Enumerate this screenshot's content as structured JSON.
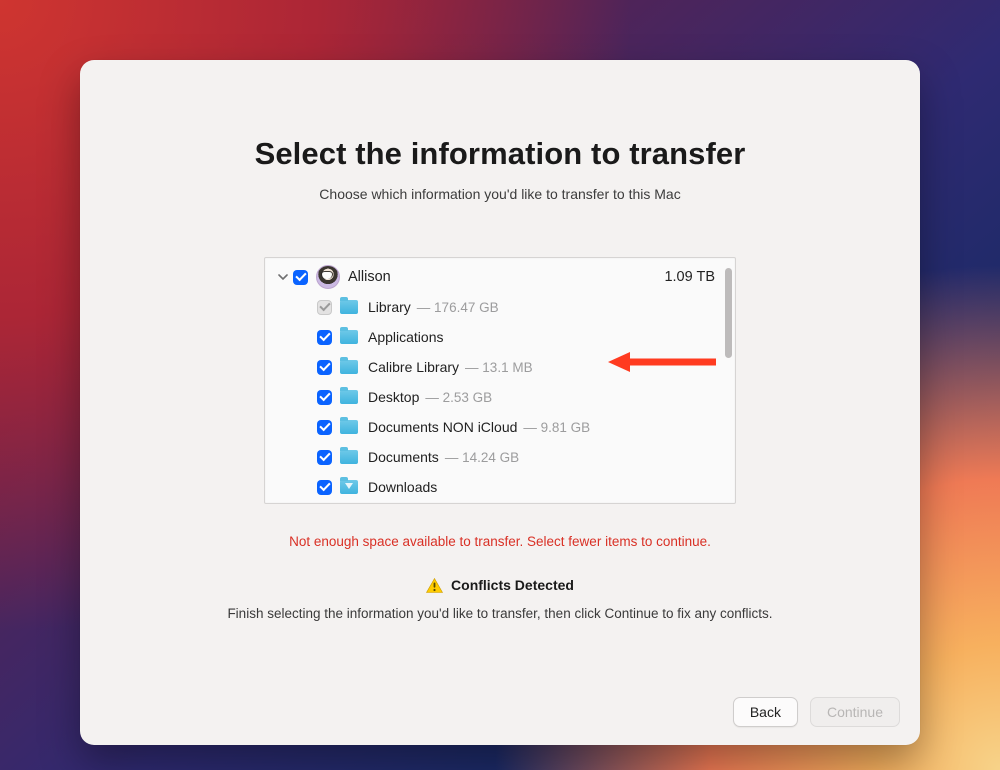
{
  "header": {
    "title": "Select the information to transfer",
    "subtitle": "Choose which information you'd like to transfer to this Mac"
  },
  "user": {
    "name": "Allison",
    "total_size": "1.09 TB"
  },
  "items": [
    {
      "label": "Library",
      "size": "176.47 GB",
      "checked": true,
      "enabled": false,
      "download_icon": false
    },
    {
      "label": "Applications",
      "size": "",
      "checked": true,
      "enabled": true,
      "download_icon": false
    },
    {
      "label": "Calibre Library",
      "size": "13.1 MB",
      "checked": true,
      "enabled": true,
      "download_icon": false
    },
    {
      "label": "Desktop",
      "size": "2.53 GB",
      "checked": true,
      "enabled": true,
      "download_icon": false
    },
    {
      "label": "Documents NON iCloud",
      "size": "9.81 GB",
      "checked": true,
      "enabled": true,
      "download_icon": false
    },
    {
      "label": "Documents",
      "size": "14.24 GB",
      "checked": true,
      "enabled": true,
      "download_icon": false
    },
    {
      "label": "Downloads",
      "size": "",
      "checked": true,
      "enabled": true,
      "download_icon": true
    }
  ],
  "error": "Not enough space available to transfer. Select fewer items to continue.",
  "conflicts": {
    "heading": "Conflicts Detected",
    "subtext": "Finish selecting the information you'd like to transfer, then click Continue to fix any conflicts."
  },
  "buttons": {
    "back": "Back",
    "continue": "Continue"
  },
  "separator": "  —  "
}
